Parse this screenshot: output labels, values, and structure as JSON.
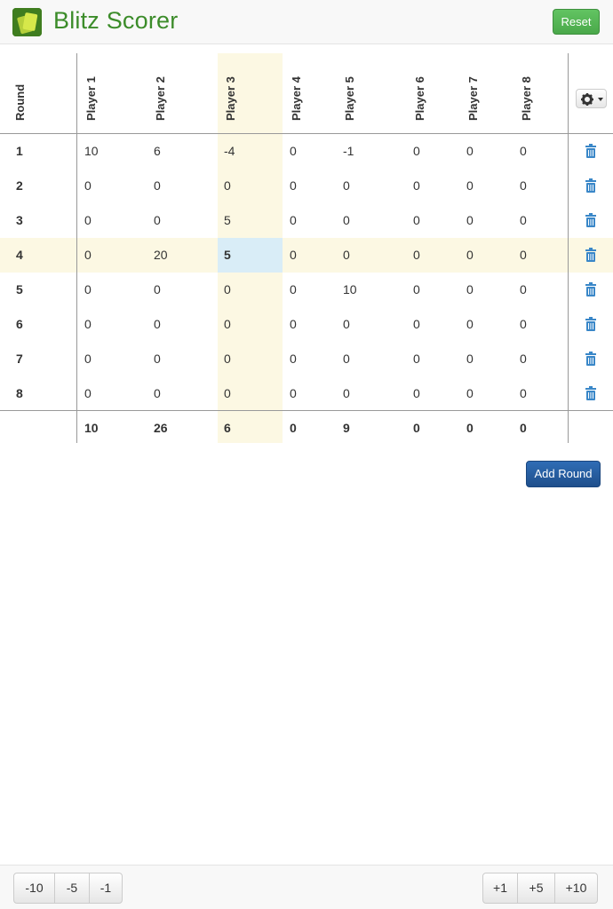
{
  "header": {
    "title": "Blitz Scorer",
    "reset_label": "Reset"
  },
  "table": {
    "round_header": "Round",
    "players": [
      "Player 1",
      "Player 2",
      "Player 3",
      "Player 4",
      "Player 5",
      "Player 6",
      "Player 7",
      "Player 8"
    ],
    "rounds": [
      {
        "round": "1",
        "scores": [
          "10",
          "6",
          "-4",
          "0",
          "-1",
          "0",
          "0",
          "0"
        ]
      },
      {
        "round": "2",
        "scores": [
          "0",
          "0",
          "0",
          "0",
          "0",
          "0",
          "0",
          "0"
        ]
      },
      {
        "round": "3",
        "scores": [
          "0",
          "0",
          "5",
          "0",
          "0",
          "0",
          "0",
          "0"
        ]
      },
      {
        "round": "4",
        "scores": [
          "0",
          "20",
          "5",
          "0",
          "0",
          "0",
          "0",
          "0"
        ]
      },
      {
        "round": "5",
        "scores": [
          "0",
          "0",
          "0",
          "0",
          "10",
          "0",
          "0",
          "0"
        ]
      },
      {
        "round": "6",
        "scores": [
          "0",
          "0",
          "0",
          "0",
          "0",
          "0",
          "0",
          "0"
        ]
      },
      {
        "round": "7",
        "scores": [
          "0",
          "0",
          "0",
          "0",
          "0",
          "0",
          "0",
          "0"
        ]
      },
      {
        "round": "8",
        "scores": [
          "0",
          "0",
          "0",
          "0",
          "0",
          "0",
          "0",
          "0"
        ]
      }
    ],
    "totals": [
      "10",
      "26",
      "6",
      "0",
      "9",
      "0",
      "0",
      "0"
    ],
    "selected_player": "Player 3",
    "selected_round": "4",
    "settings_icon": "gear-icon",
    "delete_icon": "trash-icon"
  },
  "add_round_label": "Add Round",
  "footer": {
    "minus_buttons": [
      "-10",
      "-5",
      "-1"
    ],
    "plus_buttons": [
      "+1",
      "+5",
      "+10"
    ]
  },
  "colors": {
    "brand_green": "#3c8c2a",
    "reset_green": "#5cb85c",
    "highlight": "#fcf8e3",
    "active_cell": "#d9edf7",
    "primary_blue": "#2a5f9e",
    "trash_blue": "#3a87c8"
  }
}
